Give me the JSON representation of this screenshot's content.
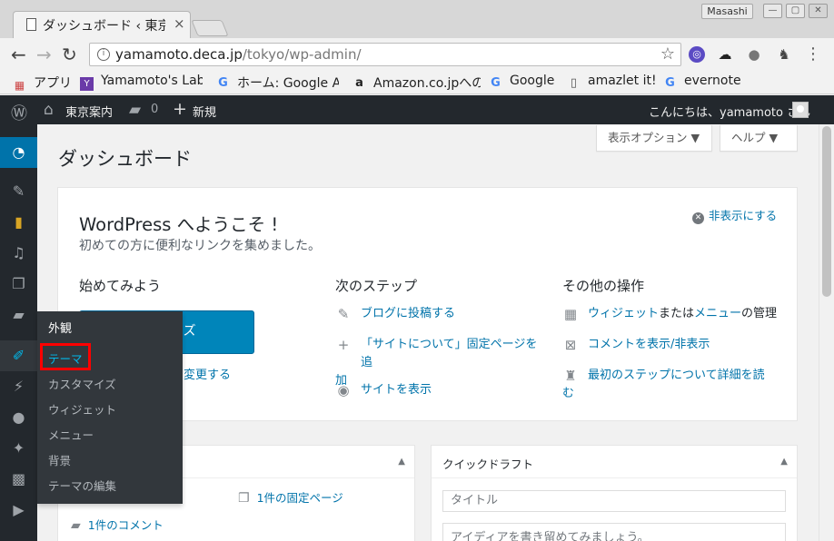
{
  "browser": {
    "tab_title": "ダッシュボード ‹ 東京",
    "tab_close": "×",
    "user_name": "Masashi",
    "win_min": "—",
    "win_max": "▢",
    "win_close": "✕",
    "url_host": "yamamoto.deca.jp",
    "url_path": "/tokyo/wp-admin/",
    "back": "←",
    "forward": "→",
    "reload": "↻",
    "info": "i",
    "star": "☆",
    "menu": "⋮",
    "bookmarks": [
      {
        "label": "アプリ",
        "icon": "apps-icon"
      },
      {
        "label": "Yamamoto's Lab",
        "icon": "yamamoto-logo-icon"
      },
      {
        "label": "ホーム: Google Ad",
        "icon": "google-icon"
      },
      {
        "label": "Amazon.co.jpへの",
        "icon": "amazon-icon"
      },
      {
        "label": "Google",
        "icon": "google-icon"
      },
      {
        "label": "amazlet it!",
        "icon": "page-icon"
      },
      {
        "label": "evernote",
        "icon": "google-icon"
      }
    ]
  },
  "adminbar": {
    "site_name": "東京案内",
    "comments_count": "0",
    "new_label": "新規",
    "greeting": "こんにちは、yamamoto さん"
  },
  "sidebar": {
    "flyout": {
      "heading": "外観",
      "items": [
        "テーマ",
        "カスタマイズ",
        "ウィジェット",
        "メニュー",
        "背景",
        "テーマの編集"
      ]
    }
  },
  "main": {
    "screen_options": "表示オプション ▼",
    "help": "ヘルプ ▼",
    "page_title": "ダッシュボード",
    "welcome": {
      "title": "WordPress へようこそ !",
      "subtitle": "初めての方に便利なリンクを集めました。",
      "dismiss": "非表示にする",
      "col1_heading": "始めてみよう",
      "customize_button": "イズ",
      "change_theme_link": "変更する",
      "col2_heading": "次のステップ",
      "next_steps": [
        {
          "label": "ブログに投稿する"
        },
        {
          "label": "「サイトについて」固定ページを追",
          "label2": "加"
        },
        {
          "label": "サイトを表示"
        }
      ],
      "col3_heading": "その他の操作",
      "more_actions": {
        "widgets": "ウィジェット",
        "or": "または",
        "menus": "メニュー",
        "manage": "の管理",
        "comments": "コメントを表示/非表示",
        "learn": "最初のステップについて詳細を読",
        "learn2": "む"
      }
    },
    "glance": {
      "pages": "1件の固定ページ",
      "comments": "1件のコメント"
    },
    "quick_draft": {
      "title": "クイックドラフト",
      "title_placeholder": "タイトル",
      "content_placeholder": "アイディアを書き留めてみましょう。"
    }
  }
}
